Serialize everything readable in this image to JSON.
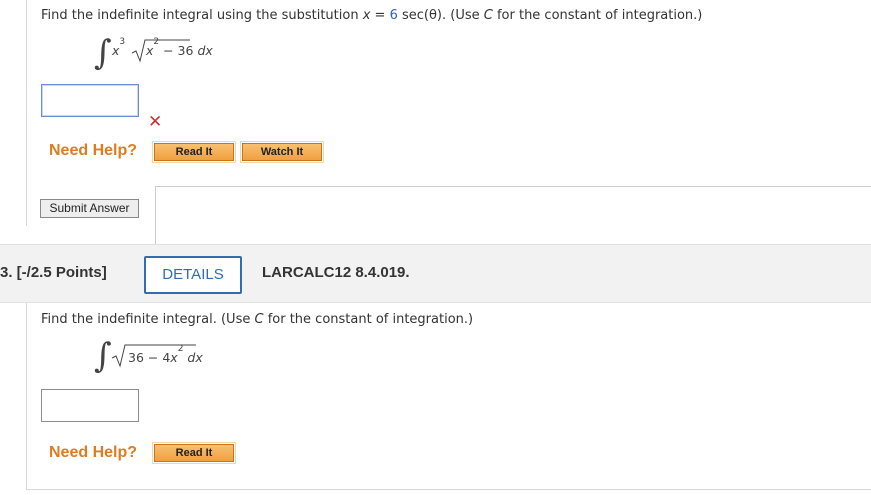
{
  "question2": {
    "prompt_prefix": "Find the indefinite integral using the substitution ",
    "sub_var": "x",
    "sub_eq": " = ",
    "sub_value": "6",
    "sub_func": " sec(θ).",
    "prompt_suffix": " (Use ",
    "const_var": "C",
    "prompt_end": " for the constant of integration.)",
    "integrand_x": "x",
    "integrand_x_exp": "3",
    "radicand_x": "x",
    "radicand_exp": "2",
    "radicand_rest": " − 36 ",
    "dx": "dx",
    "answer_value": "",
    "incorrect_mark": "✕",
    "need_help": "Need Help?",
    "read_it": "Read It",
    "watch_it": "Watch It",
    "submit": "Submit Answer"
  },
  "question3": {
    "number": "3.  [-/2.5 Points]",
    "details": "DETAILS",
    "code": "LARCALC12 8.4.019.",
    "prompt_prefix": "Find the indefinite integral. (Use ",
    "const_var": "C",
    "prompt_end": " for the constant of integration.)",
    "radicand_a": "36",
    "radicand_op": " − 4",
    "radicand_x": "x",
    "radicand_exp": "2",
    "dx": "dx",
    "answer_value": "",
    "need_help": "Need Help?",
    "read_it": "Read It"
  },
  "colors": {
    "accent_blue": "#2f6fb0",
    "help_orange": "#e07b20",
    "error_red": "#d03030"
  }
}
